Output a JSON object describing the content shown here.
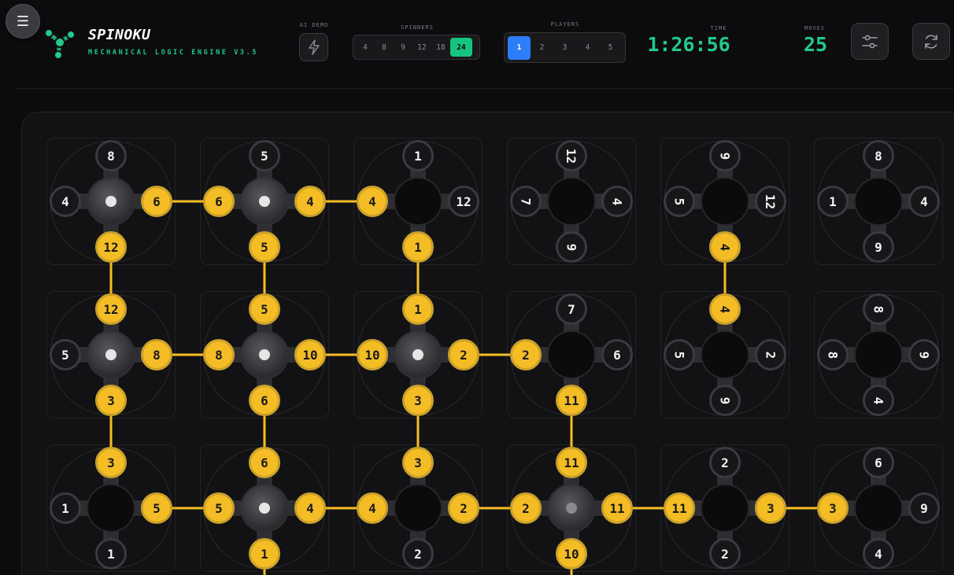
{
  "header": {
    "menu_icon": "☰",
    "title": "SPINOKU",
    "subtitle": "MECHANICAL LOGIC ENGINE V3.5",
    "ai_demo_label": "AI DEMO",
    "spinners_label": "SPINNERS",
    "spinner_options": [
      "4",
      "8",
      "9",
      "12",
      "18",
      "24"
    ],
    "spinner_selected": "24",
    "players_label": "PLAYERS",
    "player_options": [
      "1",
      "2",
      "3",
      "4",
      "5"
    ],
    "player_selected": "1",
    "time_label": "TIME",
    "time_value": "1:26:56",
    "moves_label": "MOVES",
    "moves_value": "25",
    "settings_icon": "sliders-icon",
    "refresh_icon": "refresh-icon",
    "accent_color": "#22c98a",
    "active_player_color": "#2c7ef8",
    "link_color": "#f5bd25"
  },
  "board": {
    "rows": [
      [
        {
          "top": "8",
          "right": "6",
          "bottom": "12",
          "left": "4",
          "rot": 0,
          "hub": "white",
          "on": [
            "right",
            "bottom"
          ]
        },
        {
          "top": "5",
          "right": "4",
          "bottom": "5",
          "left": "6",
          "rot": 0,
          "hub": "white",
          "on": [
            "left",
            "right",
            "bottom"
          ]
        },
        {
          "top": "1",
          "right": "12",
          "bottom": "1",
          "left": "4",
          "rot": 0,
          "hub": "none",
          "on": [
            "left",
            "bottom"
          ]
        },
        {
          "top": "12",
          "right": "4",
          "bottom": "9",
          "left": "7",
          "rot": 90,
          "hub": "none",
          "on": []
        },
        {
          "top": "9",
          "right": "12",
          "bottom": "4",
          "left": "5",
          "rot": 90,
          "hub": "none",
          "on": [
            "bottom"
          ]
        },
        {
          "top": "8",
          "right": "4",
          "bottom": "9",
          "left": "1",
          "rot": 0,
          "hub": "none",
          "on": []
        }
      ],
      [
        {
          "top": "12",
          "right": "8",
          "bottom": "3",
          "left": "5",
          "rot": 0,
          "hub": "white",
          "on": [
            "top",
            "right",
            "bottom"
          ]
        },
        {
          "top": "5",
          "right": "10",
          "bottom": "6",
          "left": "8",
          "rot": 0,
          "hub": "white",
          "on": [
            "top",
            "left",
            "right",
            "bottom"
          ]
        },
        {
          "top": "1",
          "right": "2",
          "bottom": "3",
          "left": "10",
          "rot": 0,
          "hub": "white",
          "on": [
            "top",
            "left",
            "right",
            "bottom"
          ]
        },
        {
          "top": "7",
          "right": "6",
          "bottom": "11",
          "left": "2",
          "rot": 0,
          "hub": "none",
          "on": [
            "left",
            "bottom"
          ]
        },
        {
          "top": "4",
          "right": "2",
          "bottom": "9",
          "left": "5",
          "rot": 90,
          "hub": "none",
          "on": [
            "top"
          ]
        },
        {
          "top": "8",
          "right": "9",
          "bottom": "4",
          "left": "8",
          "rot": 90,
          "hub": "none",
          "on": []
        }
      ],
      [
        {
          "top": "3",
          "right": "5",
          "bottom": "1",
          "left": "1",
          "rot": 0,
          "hub": "none",
          "on": [
            "top",
            "right"
          ]
        },
        {
          "top": "6",
          "right": "4",
          "bottom": "1",
          "left": "5",
          "rot": 0,
          "hub": "white",
          "on": [
            "top",
            "left",
            "right",
            "bottom"
          ]
        },
        {
          "top": "3",
          "right": "2",
          "bottom": "2",
          "left": "4",
          "rot": 0,
          "hub": "none",
          "on": [
            "top",
            "left",
            "right"
          ]
        },
        {
          "top": "11",
          "right": "11",
          "bottom": "10",
          "left": "2",
          "rot": 0,
          "hub": "dim",
          "on": [
            "top",
            "left",
            "right",
            "bottom"
          ]
        },
        {
          "top": "2",
          "right": "3",
          "bottom": "2",
          "left": "11",
          "rot": 0,
          "hub": "none",
          "on": [
            "left",
            "right"
          ]
        },
        {
          "top": "6",
          "right": "9",
          "bottom": "4",
          "left": "3",
          "rot": 0,
          "hub": "none",
          "on": [
            "left"
          ]
        }
      ]
    ]
  }
}
